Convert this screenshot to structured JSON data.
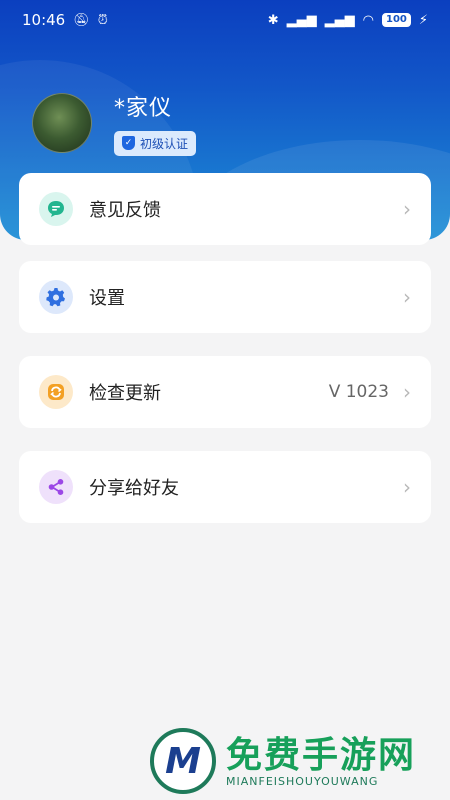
{
  "status_bar": {
    "time": "10:46",
    "battery": "100",
    "left_icons": [
      "mute-icon",
      "alarm-icon"
    ],
    "right_icons": [
      "bluetooth-icon",
      "signal-icon",
      "signal-icon",
      "wifi-icon",
      "battery-icon",
      "charging-icon"
    ]
  },
  "profile": {
    "name": "*家仪",
    "badge": "初级认证"
  },
  "menu": [
    {
      "label": "意见反馈",
      "icon": "chat-icon",
      "value": "",
      "icon_bg": "#d9f5ee",
      "icon_color": "#22b58f"
    },
    {
      "label": "设置",
      "icon": "gear-icon",
      "value": "",
      "icon_bg": "#dde8fb",
      "icon_color": "#2f6fe0"
    },
    {
      "label": "检查更新",
      "icon": "refresh-icon",
      "value": "V 1023",
      "icon_bg": "#fde9c9",
      "icon_color": "#f3a024"
    },
    {
      "label": "分享给好友",
      "icon": "share-icon",
      "value": "",
      "icon_bg": "#efe1fb",
      "icon_color": "#9b47e6"
    }
  ],
  "watermark": {
    "cn": "免费手游网",
    "en": "MIANFEISHOUYOUWANG"
  },
  "colors": {
    "header_top": "#0b3fbf",
    "header_bottom": "#1e8fd6",
    "background": "#f4f4f5",
    "card": "#ffffff"
  }
}
